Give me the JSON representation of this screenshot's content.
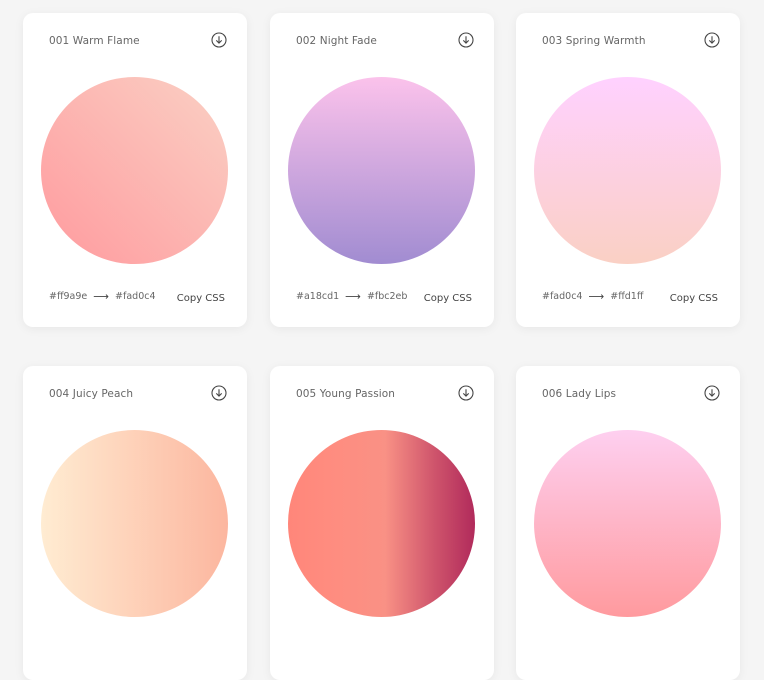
{
  "cards": [
    {
      "title": "001 Warm Flame",
      "from": "#ff9a9e",
      "to": "#fad0c4",
      "copy": "Copy CSS",
      "gradient": "linear-gradient(45deg, #ff9a9e 0%, #fad0c4 99%, #fad0c4 100%)"
    },
    {
      "title": "002 Night Fade",
      "from": "#a18cd1",
      "to": "#fbc2eb",
      "copy": "Copy CSS",
      "gradient": "linear-gradient(to top, #a18cd1 0%, #fbc2eb 100%)"
    },
    {
      "title": "003 Spring Warmth",
      "from": "#fad0c4",
      "to": "#ffd1ff",
      "copy": "Copy CSS",
      "gradient": "linear-gradient(to top, #fad0c4 0%, #ffd1ff 100%)"
    },
    {
      "title": "004 Juicy Peach",
      "from": "",
      "to": "",
      "copy": "",
      "gradient": "linear-gradient(to right, #ffecd2 0%, #fcb69f 100%)"
    },
    {
      "title": "005 Young Passion",
      "from": "",
      "to": "",
      "copy": "",
      "gradient": "linear-gradient(to right, #ff8177 0%, #ff867a 0%, #ff8c7f 21%, #f99185 52%, #cf556c 78%, #b12a5b 100%)"
    },
    {
      "title": "006 Lady Lips",
      "from": "",
      "to": "",
      "copy": "",
      "gradient": "linear-gradient(to top, #ff9a9e 0%, #fecfef 99%, #fecfef 100%)"
    }
  ],
  "arrow": "⟶",
  "icons": {
    "download": "download-icon"
  }
}
